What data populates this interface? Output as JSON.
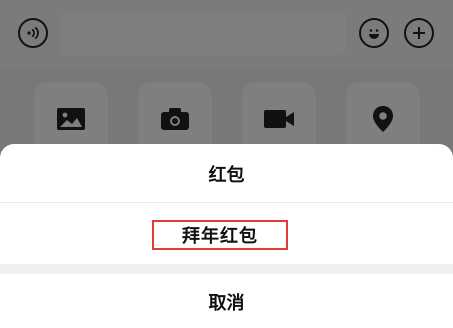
{
  "sheet": {
    "hongbao_label": "红包",
    "bainian_label": "拜年红包",
    "cancel_label": "取消"
  },
  "icons": {
    "voice": "voice-icon",
    "emoji": "emoji-icon",
    "plus": "plus-icon",
    "photo": "photo-icon",
    "camera": "camera-icon",
    "video": "video-icon",
    "location": "location-icon"
  },
  "colors": {
    "highlight_border": "#e13b33"
  }
}
